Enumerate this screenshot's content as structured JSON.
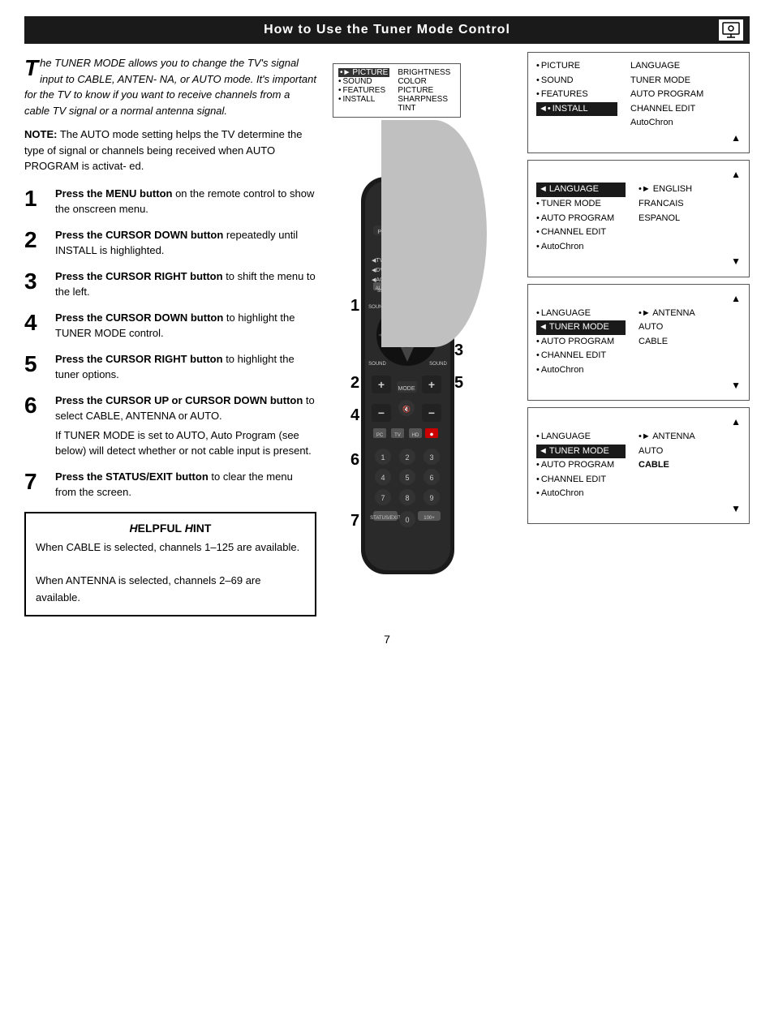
{
  "header": {
    "title": "How to Use the Tuner Mode Control"
  },
  "intro": {
    "drop_cap": "T",
    "text": "he TUNER MODE allows you to change the TV's signal input to CABLE, ANTENNA, or AUTO mode. It's important for the TV to know if you want to receive channels from a cable TV signal or a normal antenna signal."
  },
  "note": {
    "label": "NOTE:",
    "text": " The AUTO mode setting helps the TV determine the type of signal or channels being received when AUTO PROGRAM is activated."
  },
  "steps": [
    {
      "num": "1",
      "bold": "Press the MENU button",
      "text": " on the remote control to show the onscreen menu.",
      "note": ""
    },
    {
      "num": "2",
      "bold": "Press the CURSOR DOWN button",
      "text": " repeatedly until INSTALL is highlighted.",
      "note": ""
    },
    {
      "num": "3",
      "bold": "Press the CURSOR RIGHT button",
      "text": " to shift the menu to the left.",
      "note": ""
    },
    {
      "num": "4",
      "bold": "Press the CURSOR DOWN button",
      "text": " to highlight the TUNER MODE control.",
      "note": ""
    },
    {
      "num": "5",
      "bold": "Press the CURSOR RIGHT button",
      "text": " to highlight the tuner options.",
      "note": ""
    },
    {
      "num": "6",
      "bold": "Press the CURSOR UP or CURSOR DOWN button",
      "text": " to select CABLE, ANTENNA or AUTO.",
      "note": "If TUNER MODE is set to AUTO, Auto Program (see below) will detect whether or not cable input is present."
    },
    {
      "num": "7",
      "bold": "Press the STATUS/EXIT button",
      "text": " to clear the menu from the screen.",
      "note": ""
    }
  ],
  "hint": {
    "title": "Helpful Hint",
    "lines": [
      "When CABLE is selected, channels 1–125 are available.",
      "When ANTENNA is selected, channels 2–69 are available."
    ]
  },
  "tv_screen_1": {
    "left": [
      "• PICTURE",
      "• SOUND",
      "• FEATURES",
      "• INSTALL"
    ],
    "right": [
      "BRIGHTNESS",
      "COLOR",
      "PICTURE",
      "SHARPNESS",
      "TINT"
    ]
  },
  "menu_panels": [
    {
      "left": [
        "• PICTURE",
        "• SOUND",
        "• FEATURES",
        "◄• INSTALL"
      ],
      "right": [
        "LANGUAGE",
        "TUNER MODE",
        "AUTO PROGRAM",
        "CHANNEL EDIT",
        "AutoChron"
      ],
      "highlight_left": "◄• INSTALL",
      "up_arrow": "▲",
      "down_arrow": ""
    },
    {
      "left": [
        "◄ LANGUAGE",
        "• TUNER MODE",
        "• AUTO PROGRAM",
        "• CHANNEL EDIT",
        "• AutoChron"
      ],
      "right": [
        "•► ENGLISH",
        "FRANCAIS",
        "ESPANOL"
      ],
      "highlight_left": "◄ LANGUAGE",
      "up_arrow": "▲",
      "down_arrow": "▼"
    },
    {
      "left": [
        "• LANGUAGE",
        "◄ TUNER MODE",
        "• AUTO PROGRAM",
        "• CHANNEL EDIT",
        "• AutoChron"
      ],
      "right": [
        "•► ANTENNA",
        "AUTO",
        "CABLE"
      ],
      "highlight_left": "◄ TUNER MODE",
      "up_arrow": "▲",
      "down_arrow": "▼"
    },
    {
      "left": [
        "• LANGUAGE",
        "◄ TUNER MODE",
        "• AUTO PROGRAM",
        "• CHANNEL EDIT",
        "• AutoChron"
      ],
      "right": [
        "•► ANTENNA",
        "AUTO",
        "CABLE"
      ],
      "highlight_right": "CABLE",
      "highlight_left": "◄ TUNER MODE",
      "up_arrow": "▲",
      "down_arrow": "▼",
      "bold_right": [
        "•► ANTENNA",
        "AUTO",
        "CABLE"
      ]
    }
  ],
  "page_number": "7",
  "step_overlays": [
    "1",
    "2",
    "4",
    "6",
    "7",
    "3",
    "5"
  ]
}
